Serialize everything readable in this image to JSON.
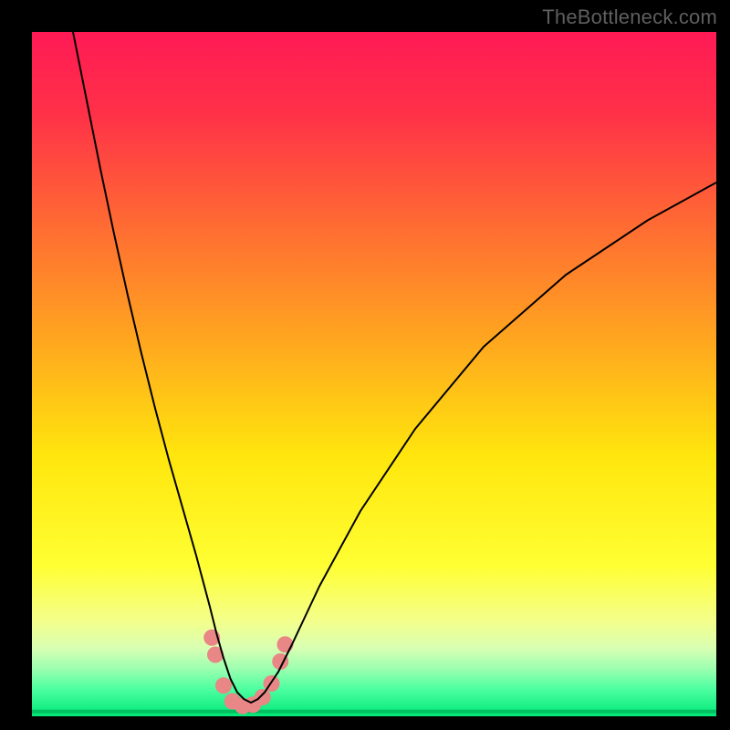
{
  "watermark": "TheBottleneck.com",
  "chart_data": {
    "type": "line",
    "title": "",
    "xlabel": "",
    "ylabel": "",
    "xlim": [
      0,
      100
    ],
    "ylim": [
      0,
      100
    ],
    "grid": false,
    "background_gradient_stops": [
      {
        "offset": 0.0,
        "color": "#ff1a55"
      },
      {
        "offset": 0.12,
        "color": "#ff3148"
      },
      {
        "offset": 0.28,
        "color": "#ff6a33"
      },
      {
        "offset": 0.45,
        "color": "#ffa61f"
      },
      {
        "offset": 0.62,
        "color": "#ffe60d"
      },
      {
        "offset": 0.78,
        "color": "#ffff33"
      },
      {
        "offset": 0.86,
        "color": "#f4ff8a"
      },
      {
        "offset": 0.9,
        "color": "#d9ffb3"
      },
      {
        "offset": 0.93,
        "color": "#9dffb0"
      },
      {
        "offset": 0.96,
        "color": "#4dffa0"
      },
      {
        "offset": 1.0,
        "color": "#00e878"
      }
    ],
    "series": [
      {
        "name": "bottleneck-curve",
        "color": "#000000",
        "width": 2,
        "x": [
          6,
          8,
          10,
          12,
          14,
          16,
          18,
          20,
          22,
          24,
          26,
          27,
          28,
          29,
          30,
          31,
          32,
          33,
          34,
          36,
          38,
          42,
          48,
          56,
          66,
          78,
          90,
          100
        ],
        "y": [
          100,
          90,
          80,
          70.5,
          61.5,
          53,
          45,
          37.5,
          30.5,
          23.5,
          16,
          12,
          8.5,
          5.5,
          3.5,
          2.5,
          2,
          2.5,
          3.5,
          6.5,
          10.5,
          19,
          30,
          42,
          54,
          64.5,
          72.5,
          78
        ]
      }
    ],
    "markers": {
      "name": "highlight-dots",
      "color": "#e98686",
      "radius": 9,
      "points": [
        {
          "x": 26.3,
          "y": 11.5
        },
        {
          "x": 26.8,
          "y": 9.0
        },
        {
          "x": 28.0,
          "y": 4.5
        },
        {
          "x": 29.3,
          "y": 2.2
        },
        {
          "x": 30.8,
          "y": 1.5
        },
        {
          "x": 32.3,
          "y": 1.7
        },
        {
          "x": 33.7,
          "y": 2.8
        },
        {
          "x": 35.0,
          "y": 4.8
        },
        {
          "x": 36.3,
          "y": 8.0
        },
        {
          "x": 37.0,
          "y": 10.5
        }
      ]
    },
    "baseline": {
      "name": "green-baseline",
      "color": "#00c060",
      "width": 4,
      "y": 0.7,
      "x_from": 0,
      "x_to": 100
    }
  }
}
